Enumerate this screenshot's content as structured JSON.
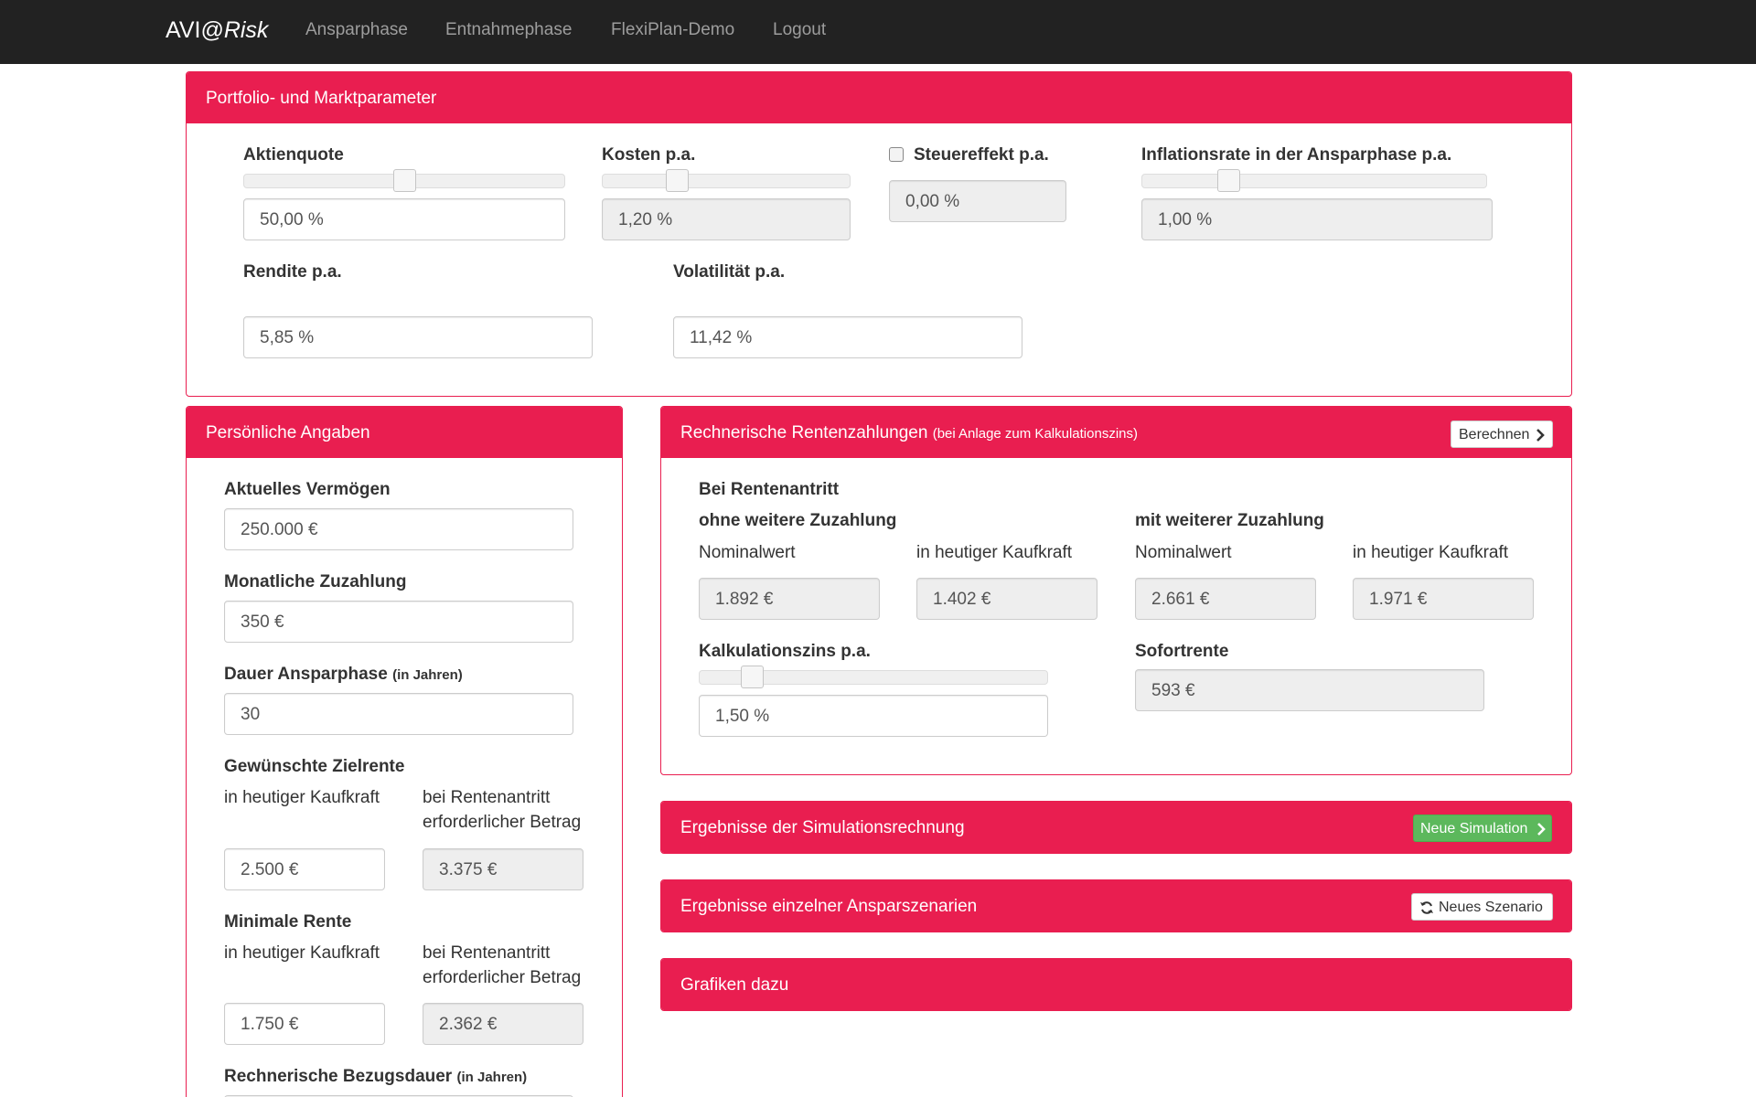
{
  "navbar": {
    "brand_prefix": "AVI@",
    "brand_suffix": "Risk",
    "links": [
      "Ansparphase",
      "Entnahmephase",
      "FlexiPlan-Demo",
      "Logout"
    ]
  },
  "portfolio": {
    "title": "Portfolio- und Marktparameter",
    "aktienquote": {
      "label": "Aktienquote",
      "value": "50,00 %",
      "slider_level": 0.5
    },
    "kosten": {
      "label": "Kosten p.a.",
      "value": "1,20 %",
      "slider_level": 0.3
    },
    "steuer": {
      "label": "Steuereffekt p.a.",
      "value": "0,00 %",
      "checked": false
    },
    "inflation": {
      "label": "Inflationsrate in der Ansparphase p.a.",
      "value": "1,00 %",
      "slider_level": 0.25
    },
    "rendite": {
      "label": "Rendite p.a.",
      "value": "5,85 %"
    },
    "volatilitaet": {
      "label": "Volatilität p.a.",
      "value": "11,42 %"
    }
  },
  "personal": {
    "title": "Persönliche Angaben",
    "vermoegen": {
      "label": "Aktuelles Vermögen",
      "value": "250.000 €"
    },
    "zuzahlung": {
      "label": "Monatliche Zuzahlung",
      "value": "350 €"
    },
    "dauer": {
      "label": "Dauer Ansparphase",
      "unit": "(in Jahren)",
      "value": "30"
    },
    "zielrente": {
      "label": "Gewünschte Zielrente",
      "col1": "in heutiger Kaufkraft",
      "col2_line1": "bei Rentenantritt",
      "col2_line2": "erforderlicher Betrag",
      "value1": "2.500 €",
      "value2": "3.375 €"
    },
    "minrente": {
      "label": "Minimale Rente",
      "col1": "in heutiger Kaufkraft",
      "col2_line1": "bei Rentenantritt",
      "col2_line2": "erforderlicher Betrag",
      "value1": "1.750 €",
      "value2": "2.362 €"
    },
    "bezugsdauer": {
      "label": "Rechnerische Bezugsdauer",
      "unit": "(in Jahren)"
    }
  },
  "renten": {
    "title": "Rechnerische Rentenzahlungen",
    "title_small": "(bei Anlage zum Kalkulationszins)",
    "button": "Berechnen",
    "bei_rentenantritt": "Bei Rentenantritt",
    "ohne": "ohne weitere Zuzahlung",
    "mit": "mit weiterer Zuzahlung",
    "col_nominal": "Nominalwert",
    "col_kaufkraft": "in heutiger Kaufkraft",
    "ohne_nominal": "1.892 €",
    "ohne_kaufkraft": "1.402 €",
    "mit_nominal": "2.661 €",
    "mit_kaufkraft": "1.971 €",
    "kalkzins": {
      "label": "Kalkulationszins p.a.",
      "value": "1,50 %",
      "slider_level": 0.15
    },
    "sofortrente": {
      "label": "Sofortrente",
      "value": "593 €"
    }
  },
  "ergebnisse": {
    "title": "Ergebnisse der Simulationsrechnung",
    "button": "Neue Simulation"
  },
  "szenarien": {
    "title": "Ergebnisse einzelner Ansparszenarien",
    "button": "Neues Szenario"
  },
  "grafiken": {
    "title": "Grafiken dazu"
  },
  "colors": {
    "accent": "#e91e50",
    "navbar": "#222222",
    "success": "#5cb85c"
  }
}
